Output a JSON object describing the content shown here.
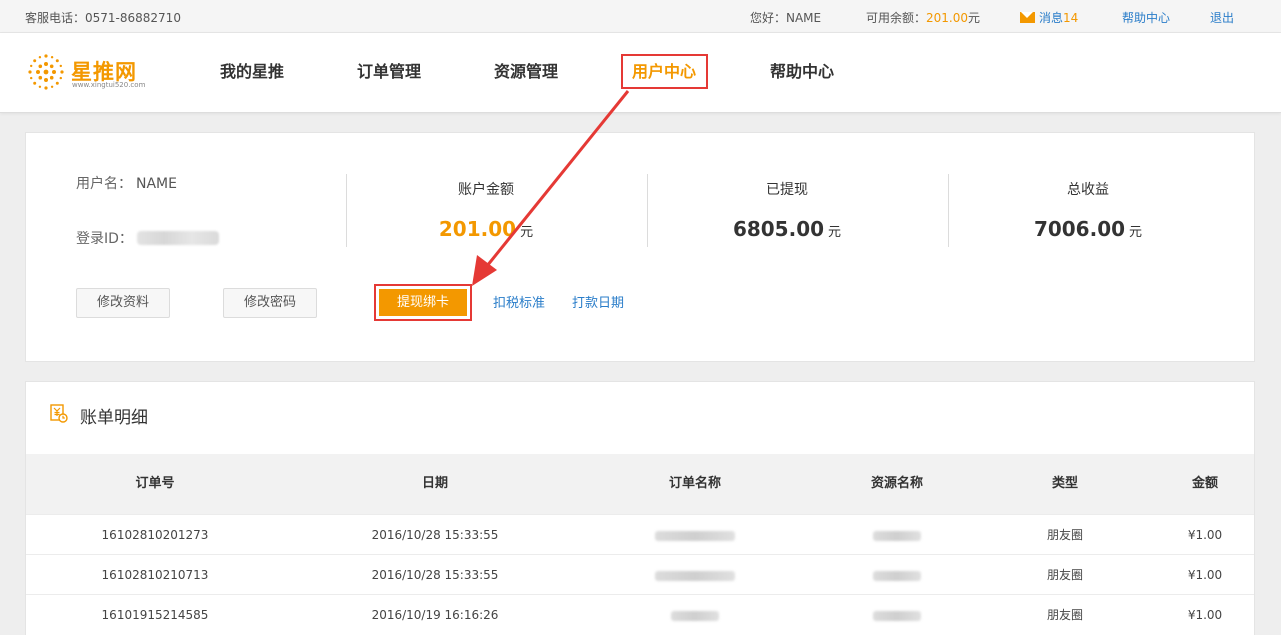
{
  "topbar": {
    "tel_label": "客服电话：0571-86882710",
    "greeting": "您好：NAME",
    "balance_label": "可用余额：",
    "balance_amount": "201.00",
    "balance_unit": "元",
    "messages_label": "消息",
    "messages_count": "14",
    "help": "帮助中心",
    "logout": "退出"
  },
  "logo": {
    "name": "星推网",
    "url": "www.xingtui520.com"
  },
  "nav": [
    {
      "label": "我的星推"
    },
    {
      "label": "订单管理"
    },
    {
      "label": "资源管理"
    },
    {
      "label": "用户中心",
      "active": true
    },
    {
      "label": "帮助中心"
    }
  ],
  "account": {
    "username_label": "用户名：",
    "username": "NAME",
    "login_id_label": "登录ID：",
    "stats": [
      {
        "label": "账户金额",
        "value": "201.00",
        "unit": "元"
      },
      {
        "label": "已提现",
        "value": "6805.00",
        "unit": "元"
      },
      {
        "label": "总收益",
        "value": "7006.00",
        "unit": "元"
      }
    ],
    "edit_profile": "修改资料",
    "change_password": "修改密码",
    "withdraw_bind_card": "提现绑卡",
    "tax_standard": "扣税标准",
    "payment_date": "打款日期"
  },
  "bill": {
    "title": "账单明细",
    "columns": [
      "订单号",
      "日期",
      "订单名称",
      "资源名称",
      "类型",
      "金额"
    ],
    "rows": [
      {
        "order_no": "16102810201273",
        "date": "2016/10/28 15:33:55",
        "type": "朋友圈",
        "amount": "¥1.00"
      },
      {
        "order_no": "16102810210713",
        "date": "2016/10/28 15:33:55",
        "type": "朋友圈",
        "amount": "¥1.00"
      },
      {
        "order_no": "16101915214585",
        "date": "2016/10/19 16:16:26",
        "type": "朋友圈",
        "amount": "¥1.00"
      }
    ]
  },
  "colors": {
    "accent": "#f39800",
    "link": "#2a7dc9",
    "highlight": "#e53935"
  }
}
